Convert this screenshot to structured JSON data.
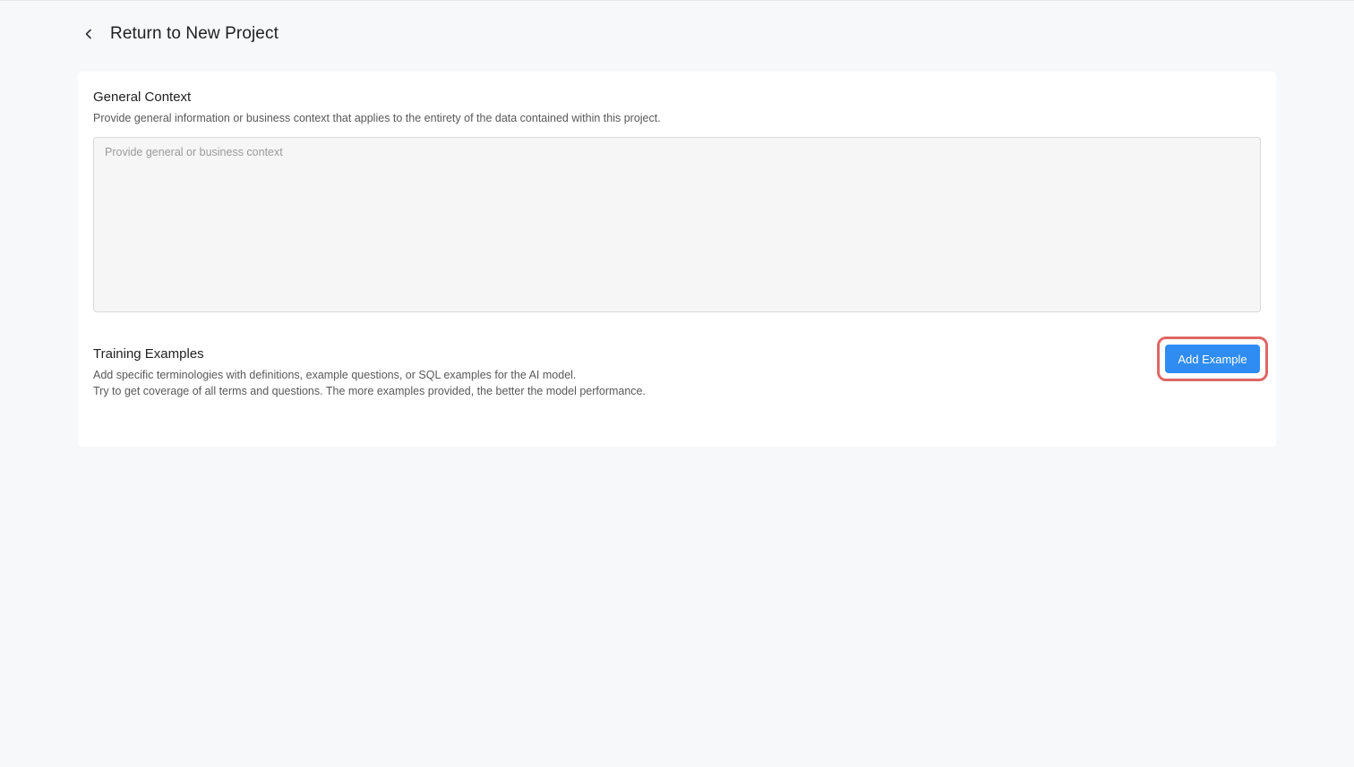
{
  "header": {
    "back_icon": "chevron-left-icon",
    "title": "Return to New Project"
  },
  "general_context": {
    "title": "General Context",
    "description": "Provide general information or business context that applies to the entirety of the data contained within this project.",
    "value": "",
    "placeholder": "Provide general or business context"
  },
  "training_examples": {
    "title": "Training Examples",
    "description_line1": "Add specific terminologies with definitions, example questions, or SQL examples for the AI model.",
    "description_line2": "Try to get coverage of all terms and questions. The more examples provided, the better the model performance.",
    "add_button_label": "Add Example"
  },
  "colors": {
    "accent": "#2f8cf2",
    "highlight": "#e06666",
    "background": "#f7f8fa"
  }
}
